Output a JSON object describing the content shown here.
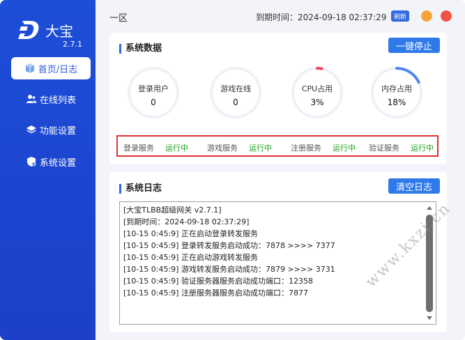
{
  "app": {
    "name": "大宝",
    "version": "2.7.1",
    "accent": "#1d4ed8"
  },
  "sidebar": {
    "items": [
      {
        "label": "首页/日志",
        "icon": "cube-icon",
        "active": true
      },
      {
        "label": "在线列表",
        "icon": "users-icon",
        "active": false
      },
      {
        "label": "功能设置",
        "icon": "layers-icon",
        "active": false
      },
      {
        "label": "系统设置",
        "icon": "shield-gear-icon",
        "active": false
      }
    ]
  },
  "header": {
    "zone": "一区",
    "expire": "到期时间：2024-09-18 02:37:29",
    "refresh_label": "刷新"
  },
  "system_data": {
    "title": "系统数据",
    "stop_button": "一键停止",
    "gauges": [
      {
        "label": "登录用户",
        "value": "0",
        "fraction": 0
      },
      {
        "label": "游戏在线",
        "value": "0",
        "fraction": 0
      },
      {
        "label": "CPU占用",
        "value": "3%",
        "fraction": 0.03,
        "color": "#f04860"
      },
      {
        "label": "内存占用",
        "value": "18%",
        "fraction": 0.18,
        "color": "#4f86f0"
      }
    ],
    "services": [
      {
        "name": "登录服务",
        "state": "运行中"
      },
      {
        "name": "游戏服务",
        "state": "运行中"
      },
      {
        "name": "注册服务",
        "state": "运行中"
      },
      {
        "name": "验证服务",
        "state": "运行中"
      }
    ]
  },
  "system_log": {
    "title": "系统日志",
    "clear_button": "清空日志",
    "lines": [
      "[大宝TLBB超级网关 v2.7.1]",
      "[到期时间：2024-09-18 02:37:29]",
      "[10-15 0:45:9] 正在启动登录转发服务",
      "[10-15 0:45:9] 登录转发服务启动成功：7878 >>>> 7377",
      "[10-15 0:45:9] 正在启动游戏转发服务",
      "[10-15 0:45:9] 游戏转发服务启动成功：7879 >>>> 3731",
      "[10-15 0:45:9] 验证服务器服务启动成功端口：12358",
      "[10-15 0:45:9] 注册服务器服务启动成功端口：7877"
    ]
  },
  "watermark": "www.kxzi.cn"
}
